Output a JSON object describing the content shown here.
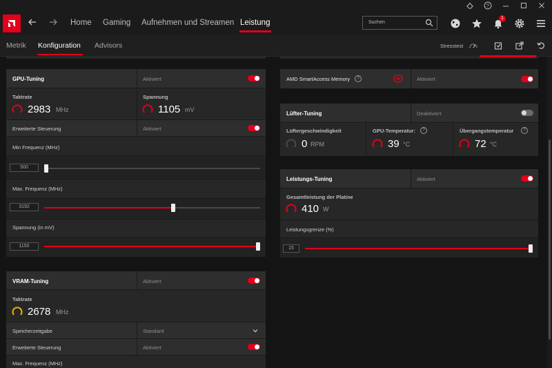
{
  "nav": {
    "items": [
      "Home",
      "Gaming",
      "Aufnehmen und Streamen",
      "Leistung"
    ],
    "active": "Leistung",
    "search_placeholder": "Suchen",
    "notification_count": "1"
  },
  "subnav": {
    "items": [
      "Metrik",
      "Konfiguration",
      "Advisors"
    ],
    "active": "Konfiguration",
    "stress_label": "Stresstest"
  },
  "gpu_tuning": {
    "title": "GPU-Tuning",
    "status": "Aktiviert",
    "clock_label": "Taktrate",
    "clock_value": "2983",
    "clock_unit": "MHz",
    "voltage_label": "Spannung",
    "voltage_value": "1105",
    "voltage_unit": "mV",
    "advanced_label": "Erweiterte Steuerung",
    "advanced_status": "Aktiviert",
    "min_freq_label": "Min Frequenz (MHz)",
    "min_freq_value": "500",
    "min_freq_fraction": 0.0,
    "max_freq_label": "Max. Frequenz (MHz)",
    "max_freq_value": "3192",
    "max_freq_fraction": 0.6,
    "voltage_slider_label": "Spannung (in mV)",
    "voltage_slider_value": "1150",
    "voltage_slider_fraction": 1.0
  },
  "vram_tuning": {
    "title": "VRAM-Tuning",
    "status": "Aktiviert",
    "clock_label": "Taktrate",
    "clock_value": "2678",
    "clock_unit": "MHz",
    "timing_label": "Speicherzeitgabe",
    "timing_value": "Standard",
    "advanced_label": "Erweiterte Steuerung",
    "advanced_status": "Aktiviert",
    "max_freq_label": "Max. Frequenz (MHz)"
  },
  "smart_access": {
    "title": "AMD SmartAccess Memory",
    "status": "Aktiviert"
  },
  "fan_tuning": {
    "title": "Lüfter-Tuning",
    "status": "Deaktiviert",
    "fan_speed_label": "Lüftergeschwindigkeit",
    "fan_speed_value": "0",
    "fan_speed_unit": "RPM",
    "gpu_temp_label": "GPU-Temperatur:",
    "gpu_temp_value": "39",
    "gpu_temp_unit": "°C",
    "junction_temp_label": "Übergangstemperatur",
    "junction_temp_value": "72",
    "junction_temp_unit": "°C"
  },
  "power_tuning": {
    "title": "Leistungs-Tuning",
    "status": "Aktiviert",
    "board_power_label": "Gesamtleistung der Platine",
    "board_power_value": "410",
    "board_power_unit": "W",
    "limit_label": "Leistungsgrenze (%)",
    "limit_value": "15",
    "limit_fraction": 1.0
  },
  "colors": {
    "accent": "#e2001a",
    "background": "#141414",
    "panel": "#272727",
    "vram_gauge": "#e8b400"
  },
  "icons": [
    "amd-logo-icon",
    "back-arrow-icon",
    "forward-arrow-icon",
    "search-icon",
    "globe-icon",
    "star-icon",
    "bell-icon",
    "gear-icon",
    "menu-icon",
    "bug-icon",
    "help-icon",
    "minimize-icon",
    "maximize-icon",
    "close-icon",
    "stress-gauge-icon",
    "export-icon",
    "import-icon",
    "reset-icon",
    "info-icon",
    "memory-icon",
    "chevron-down-icon"
  ]
}
